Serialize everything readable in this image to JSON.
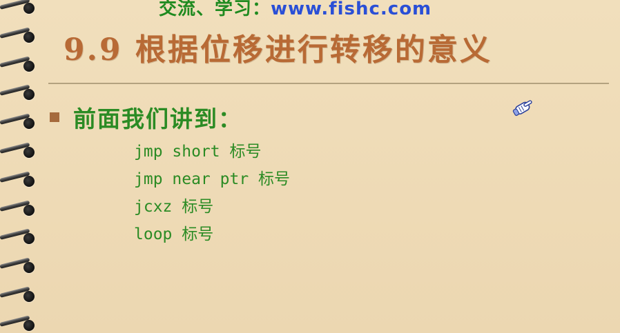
{
  "header": {
    "prefix": "交流、学习：",
    "url": "www.fishc.com"
  },
  "slide": {
    "title": "9.9 根据位移进行转移的意义",
    "bullet": "前面我们讲到：",
    "code_lines": [
      "jmp short 标号",
      "jmp near ptr 标号",
      "jcxz 标号",
      "loop 标号"
    ]
  },
  "colors": {
    "background": "#efdcb8",
    "title": "#b86a35",
    "text_green": "#2b8b24",
    "url_blue": "#2a4fd6",
    "bullet_square": "#a56a3c"
  },
  "icons": {
    "cursor": "pointing-hand-cursor-icon",
    "binding": "spiral-binding"
  }
}
